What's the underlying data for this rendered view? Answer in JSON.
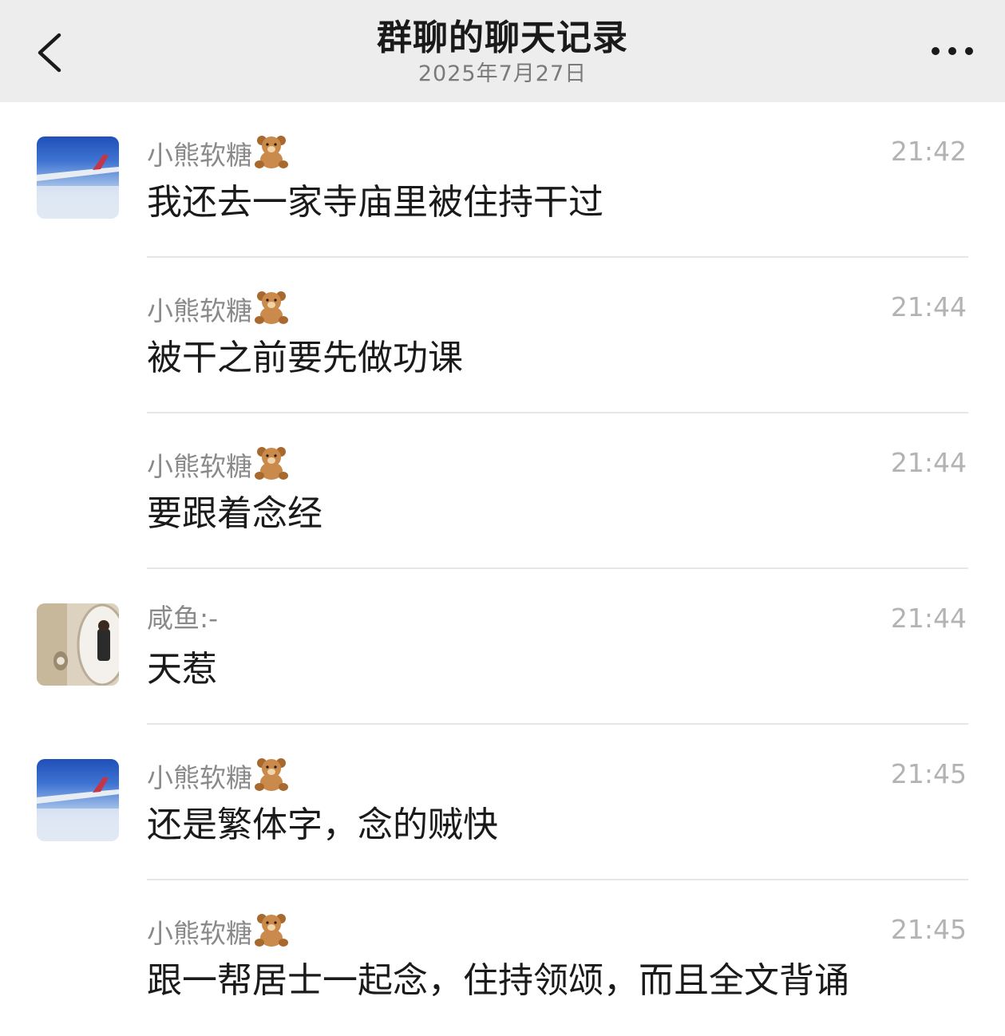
{
  "header": {
    "title": "群聊的聊天记录",
    "date": "2025年7月27日",
    "back_icon": "chevron-left-icon",
    "more_icon": "more-dots-icon"
  },
  "messages": [
    {
      "sender": "小熊软糖",
      "sender_emoji": "teddy-bear-icon",
      "time": "21:42",
      "text": "我还去一家寺庙里被住持干过",
      "avatar": "airplane-wing-avatar",
      "show_avatar": true
    },
    {
      "sender": "小熊软糖",
      "sender_emoji": "teddy-bear-icon",
      "time": "21:44",
      "text": "被干之前要先做功课",
      "show_avatar": false
    },
    {
      "sender": "小熊软糖",
      "sender_emoji": "teddy-bear-icon",
      "time": "21:44",
      "text": "要跟着念经",
      "show_avatar": false
    },
    {
      "sender": "咸鱼:-",
      "time": "21:44",
      "text": "天惹",
      "avatar": "mirror-selfie-avatar",
      "show_avatar": true
    },
    {
      "sender": "小熊软糖",
      "sender_emoji": "teddy-bear-icon",
      "time": "21:45",
      "text": "还是繁体字，念的贼快",
      "avatar": "airplane-wing-avatar",
      "show_avatar": true
    },
    {
      "sender": "小熊软糖",
      "sender_emoji": "teddy-bear-icon",
      "time": "21:45",
      "text": "跟一帮居士一起念，住持领颂，而且全文背诵",
      "show_avatar": false
    }
  ],
  "colors": {
    "header_bg": "#ededed",
    "sender": "#8a8a8a",
    "time": "#b3b3b3",
    "text": "#1a1a1a",
    "divider": "#e6e6e6"
  }
}
